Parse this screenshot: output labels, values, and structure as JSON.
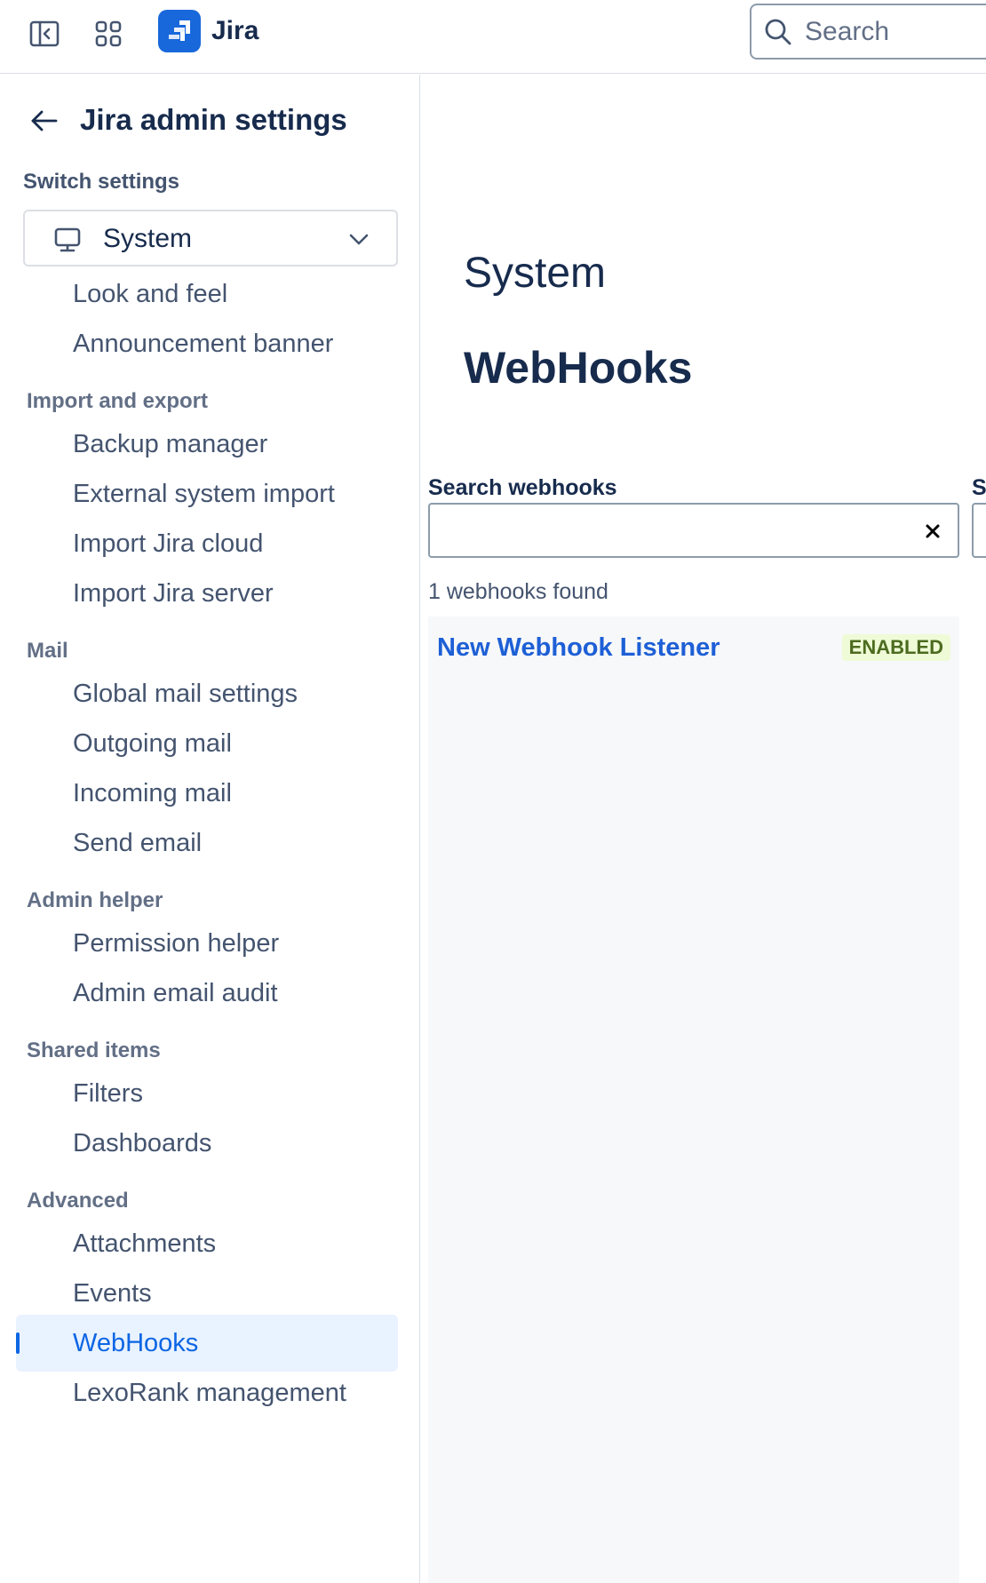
{
  "topbar": {
    "brand": "Jira",
    "search_placeholder": "Search"
  },
  "sidebar": {
    "title": "Jira admin settings",
    "switch_label": "Switch settings",
    "select_value": "System",
    "top_items": [
      {
        "label": "Look and feel"
      },
      {
        "label": "Announcement banner"
      }
    ],
    "sections": [
      {
        "title": "Import and export",
        "items": [
          "Backup manager",
          "External system import",
          "Import Jira cloud",
          "Import Jira server"
        ]
      },
      {
        "title": "Mail",
        "items": [
          "Global mail settings",
          "Outgoing mail",
          "Incoming mail",
          "Send email"
        ]
      },
      {
        "title": "Admin helper",
        "items": [
          "Permission helper",
          "Admin email audit"
        ]
      },
      {
        "title": "Shared items",
        "items": [
          "Filters",
          "Dashboards"
        ]
      },
      {
        "title": "Advanced",
        "items": [
          "Attachments",
          "Events",
          "WebHooks",
          "LexoRank management"
        ]
      }
    ],
    "active_item": "WebHooks"
  },
  "main": {
    "section_title": "System",
    "page_title": "WebHooks",
    "search_label": "Search webhooks",
    "second_label": "S",
    "count_text": "1 webhooks found",
    "webhooks": [
      {
        "name": "New Webhook Listener",
        "status": "ENABLED"
      }
    ]
  },
  "colors": {
    "accent": "#0c66e4",
    "logo": "#1868db",
    "active_bg": "#e9f2ff",
    "link": "#1d5fd6",
    "enabled_bg": "#effbd7",
    "enabled_text": "#4c6b1f"
  }
}
